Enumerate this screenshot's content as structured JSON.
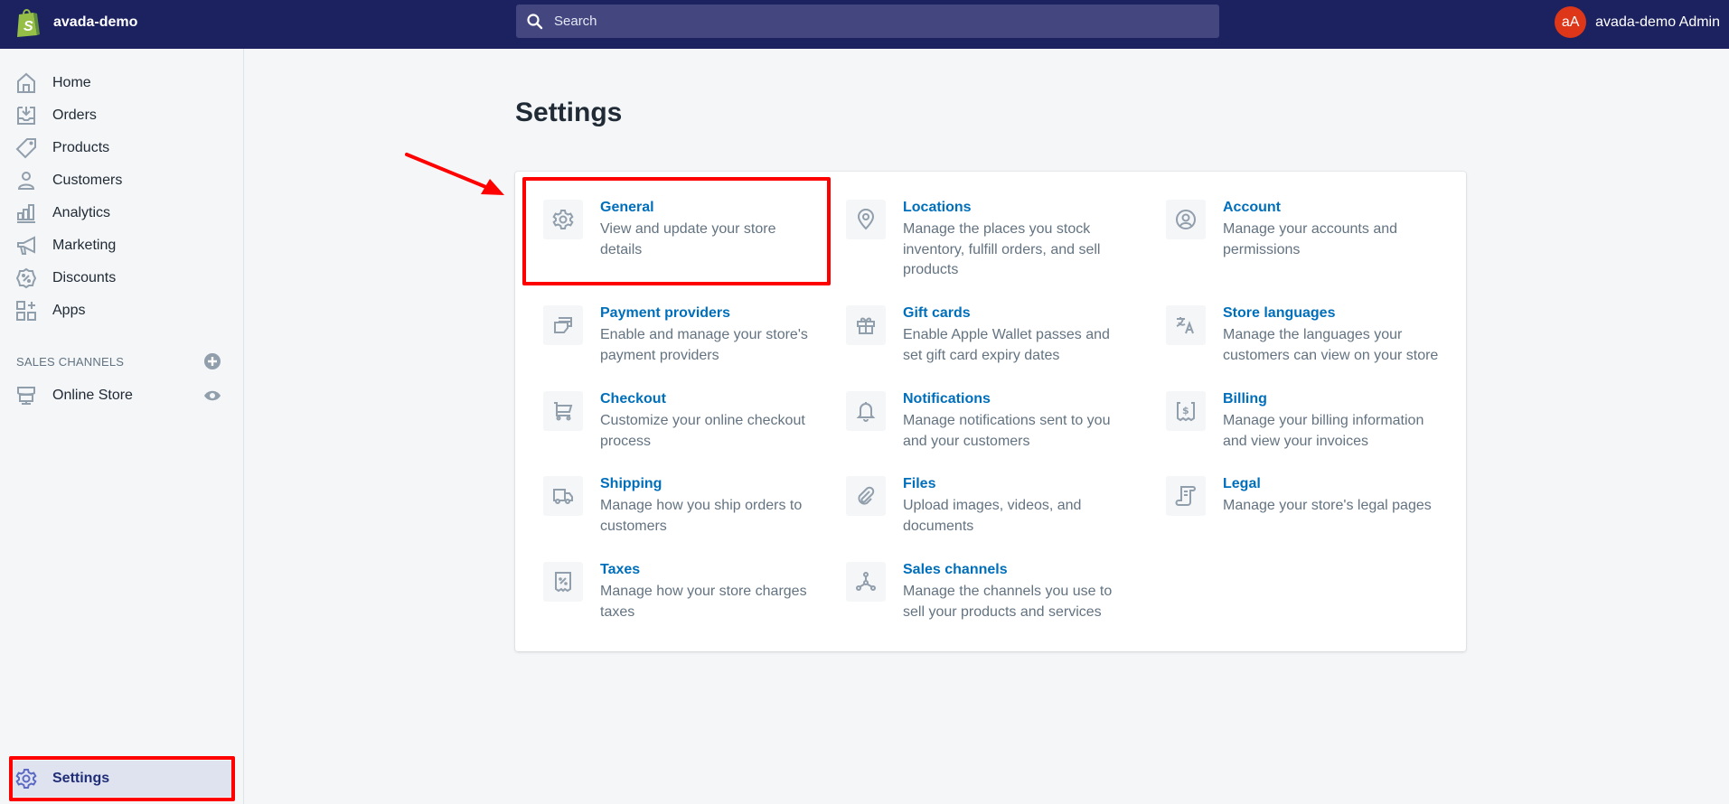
{
  "topbar": {
    "store_name": "avada-demo",
    "search_placeholder": "Search",
    "avatar_initials": "aA",
    "user_name": "avada-demo Admin",
    "colors": {
      "bar": "#1c2260",
      "search": "#43467f",
      "avatar": "#de3618"
    }
  },
  "sidebar": {
    "items": [
      {
        "label": "Home",
        "icon": "home-icon"
      },
      {
        "label": "Orders",
        "icon": "orders-icon"
      },
      {
        "label": "Products",
        "icon": "tag-icon"
      },
      {
        "label": "Customers",
        "icon": "person-icon"
      },
      {
        "label": "Analytics",
        "icon": "bar-chart-icon"
      },
      {
        "label": "Marketing",
        "icon": "megaphone-icon"
      },
      {
        "label": "Discounts",
        "icon": "discount-icon"
      },
      {
        "label": "Apps",
        "icon": "apps-icon"
      }
    ],
    "sales_channels_title": "SALES CHANNELS",
    "channels": [
      {
        "label": "Online Store",
        "icon": "store-icon"
      }
    ],
    "settings_label": "Settings"
  },
  "main": {
    "title": "Settings",
    "settings": [
      {
        "title": "General",
        "description": "View and update your store details",
        "icon": "gear-icon"
      },
      {
        "title": "Locations",
        "description": "Manage the places you stock inventory, fulfill orders, and sell products",
        "icon": "location-pin-icon"
      },
      {
        "title": "Account",
        "description": "Manage your accounts and permissions",
        "icon": "account-icon"
      },
      {
        "title": "Payment providers",
        "description": "Enable and manage your store's payment providers",
        "icon": "payment-icon"
      },
      {
        "title": "Gift cards",
        "description": "Enable Apple Wallet passes and set gift card expiry dates",
        "icon": "gift-icon"
      },
      {
        "title": "Store languages",
        "description": "Manage the languages your customers can view on your store",
        "icon": "translate-icon"
      },
      {
        "title": "Checkout",
        "description": "Customize your online checkout process",
        "icon": "cart-icon"
      },
      {
        "title": "Notifications",
        "description": "Manage notifications sent to you and your customers",
        "icon": "bell-icon"
      },
      {
        "title": "Billing",
        "description": "Manage your billing information and view your invoices",
        "icon": "billing-icon"
      },
      {
        "title": "Shipping",
        "description": "Manage how you ship orders to customers",
        "icon": "truck-icon"
      },
      {
        "title": "Files",
        "description": "Upload images, videos, and documents",
        "icon": "paperclip-icon"
      },
      {
        "title": "Legal",
        "description": "Manage your store's legal pages",
        "icon": "legal-icon"
      },
      {
        "title": "Taxes",
        "description": "Manage how your store charges taxes",
        "icon": "tax-icon"
      },
      {
        "title": "Sales channels",
        "description": "Manage the channels you use to sell your products and services",
        "icon": "sales-channels-icon"
      }
    ]
  },
  "annotations": {
    "color": "#ff0000"
  }
}
